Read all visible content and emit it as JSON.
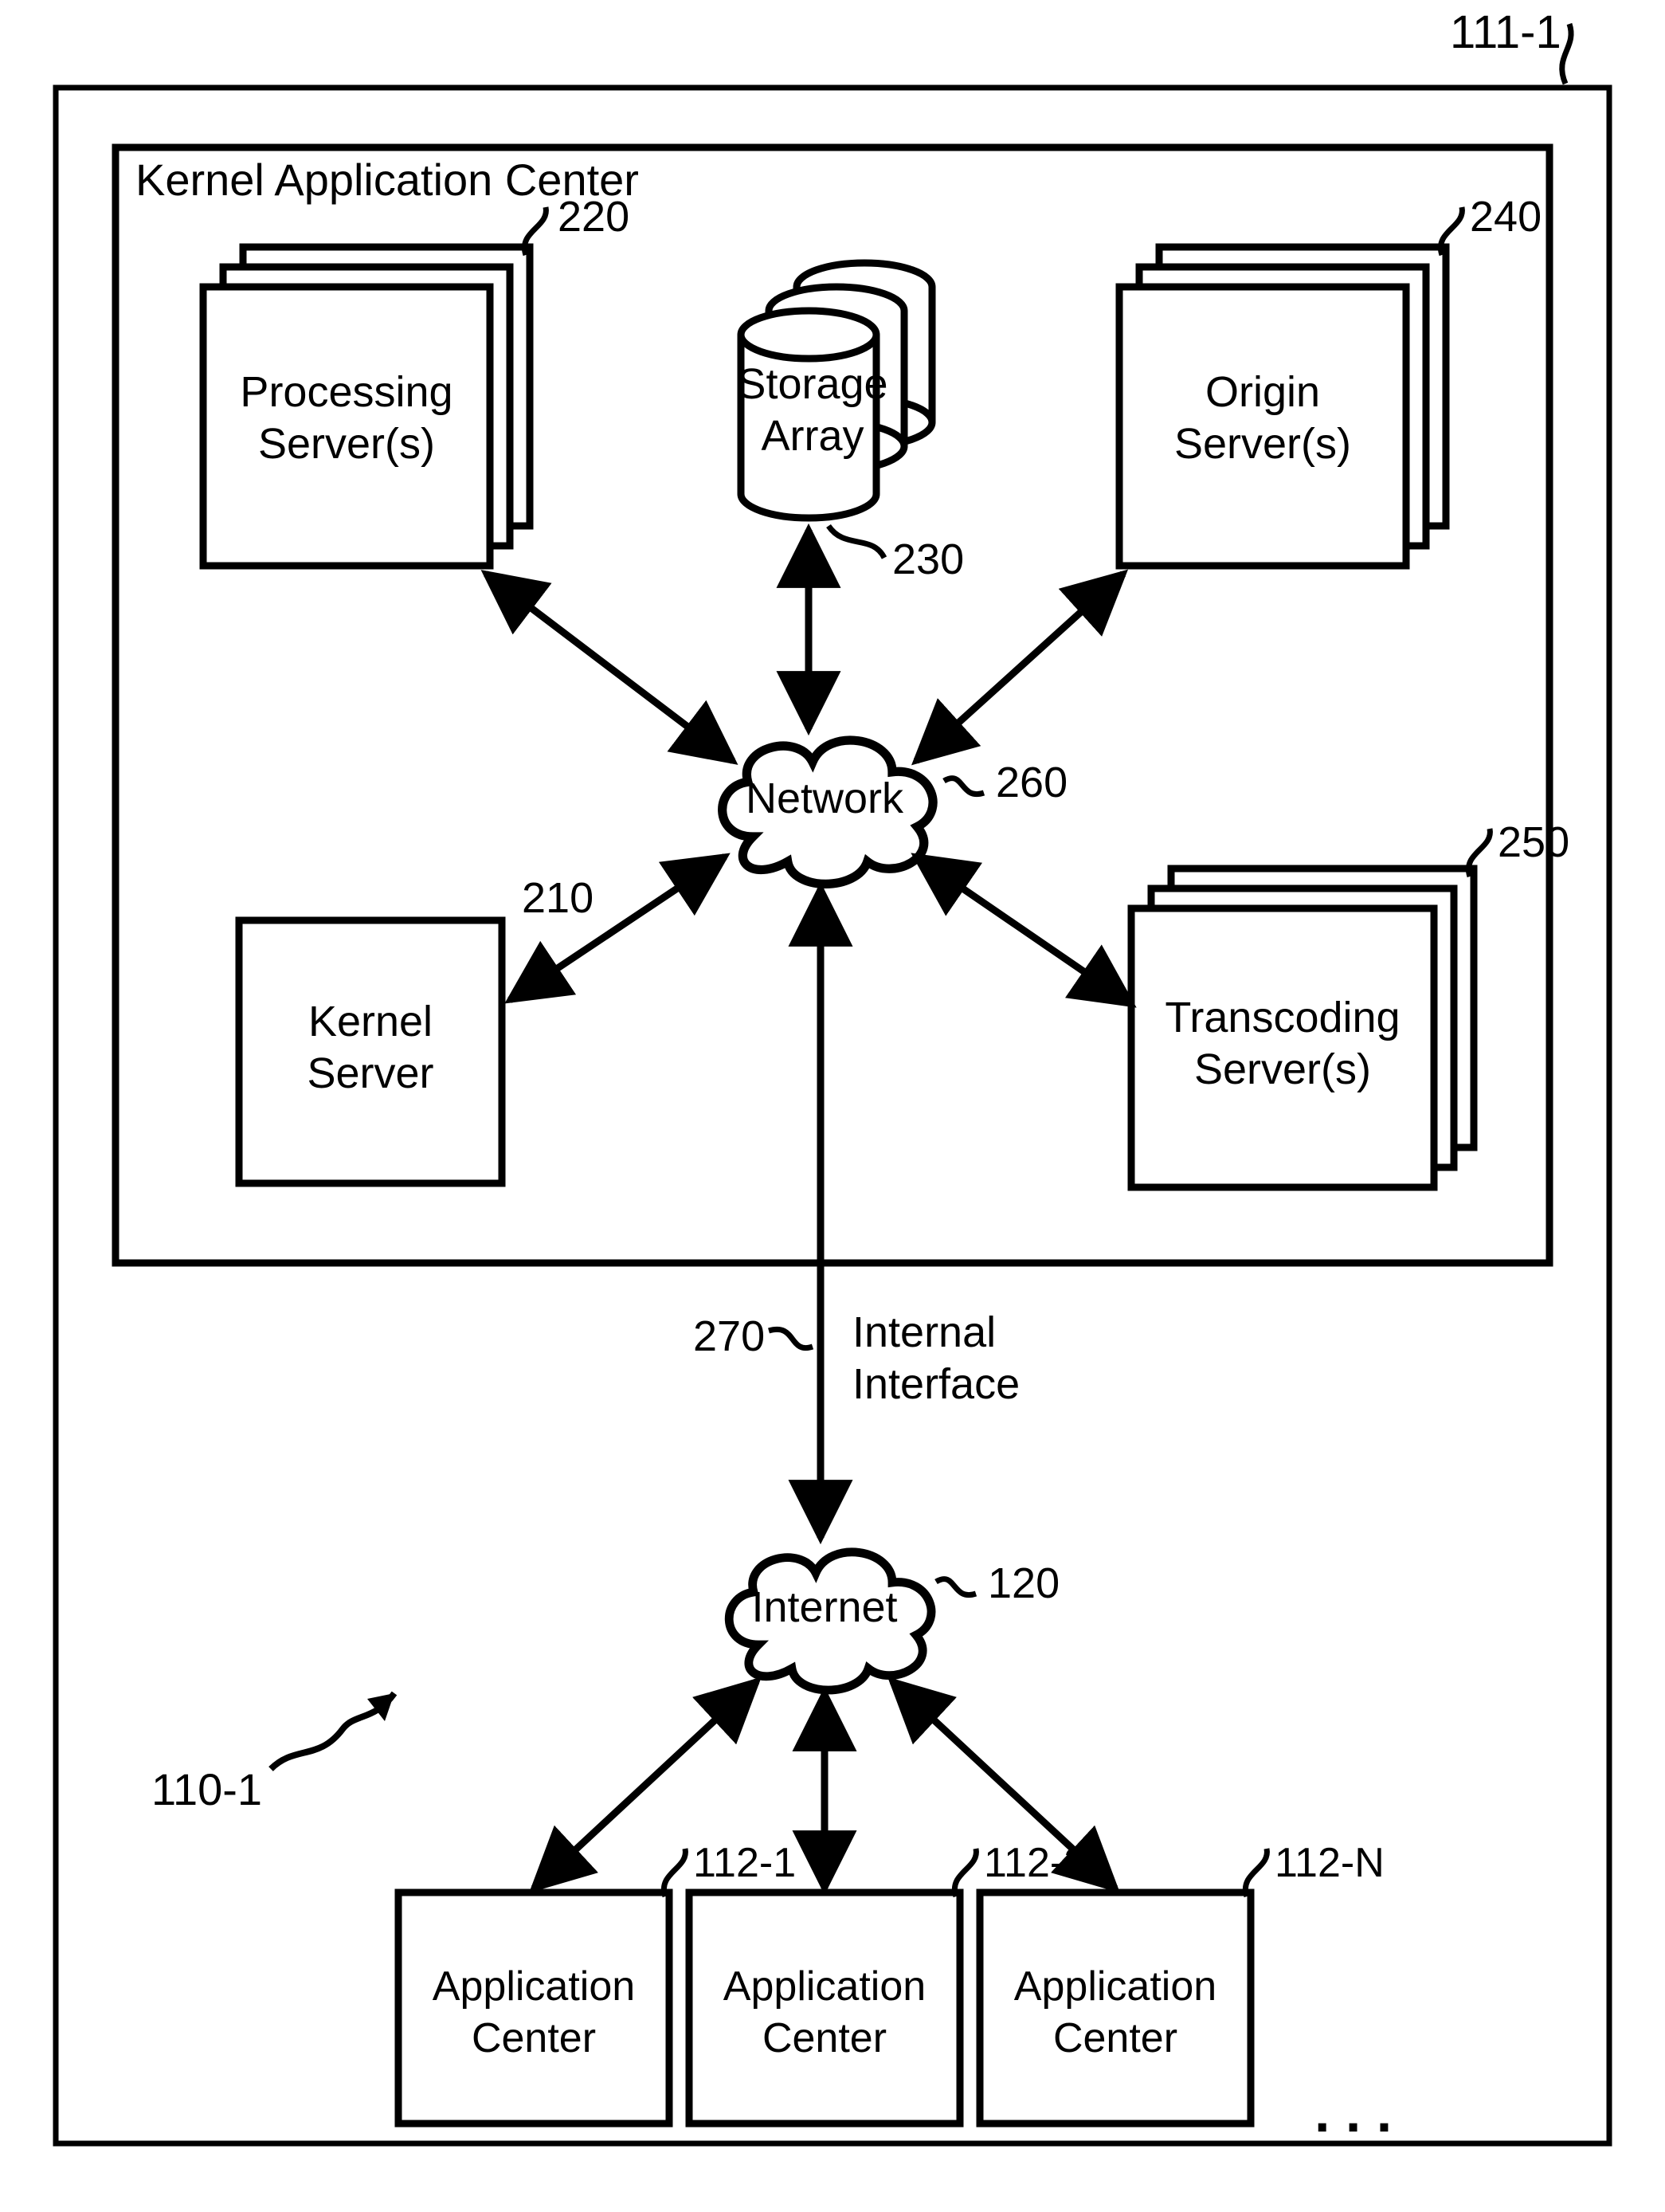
{
  "frame": {
    "label": "111-1"
  },
  "kac": {
    "title": "Kernel Application Center"
  },
  "processing": {
    "line1": "Processing",
    "line2": "Server(s)",
    "ref": "220"
  },
  "storage": {
    "line1": "Storage",
    "line2": "Array",
    "ref": "230"
  },
  "origin": {
    "line1": "Origin",
    "line2": "Server(s)",
    "ref": "240"
  },
  "kernel": {
    "line1": "Kernel",
    "line2": "Server",
    "ref": "210"
  },
  "transcoding": {
    "line1": "Transcoding",
    "line2": "Server(s)",
    "ref": "250"
  },
  "network": {
    "label": "Network",
    "ref": "260"
  },
  "internal_interface": {
    "ref": "270",
    "line1": "Internal",
    "line2": "Interface"
  },
  "internet": {
    "label": "Internet",
    "ref": "120"
  },
  "figure_ref": {
    "label": "110-1"
  },
  "appcenters": {
    "line1": "Application",
    "line2": "Center",
    "refs": [
      "112-1",
      "112-2",
      "112-N"
    ]
  },
  "ellipsis": ". . ."
}
